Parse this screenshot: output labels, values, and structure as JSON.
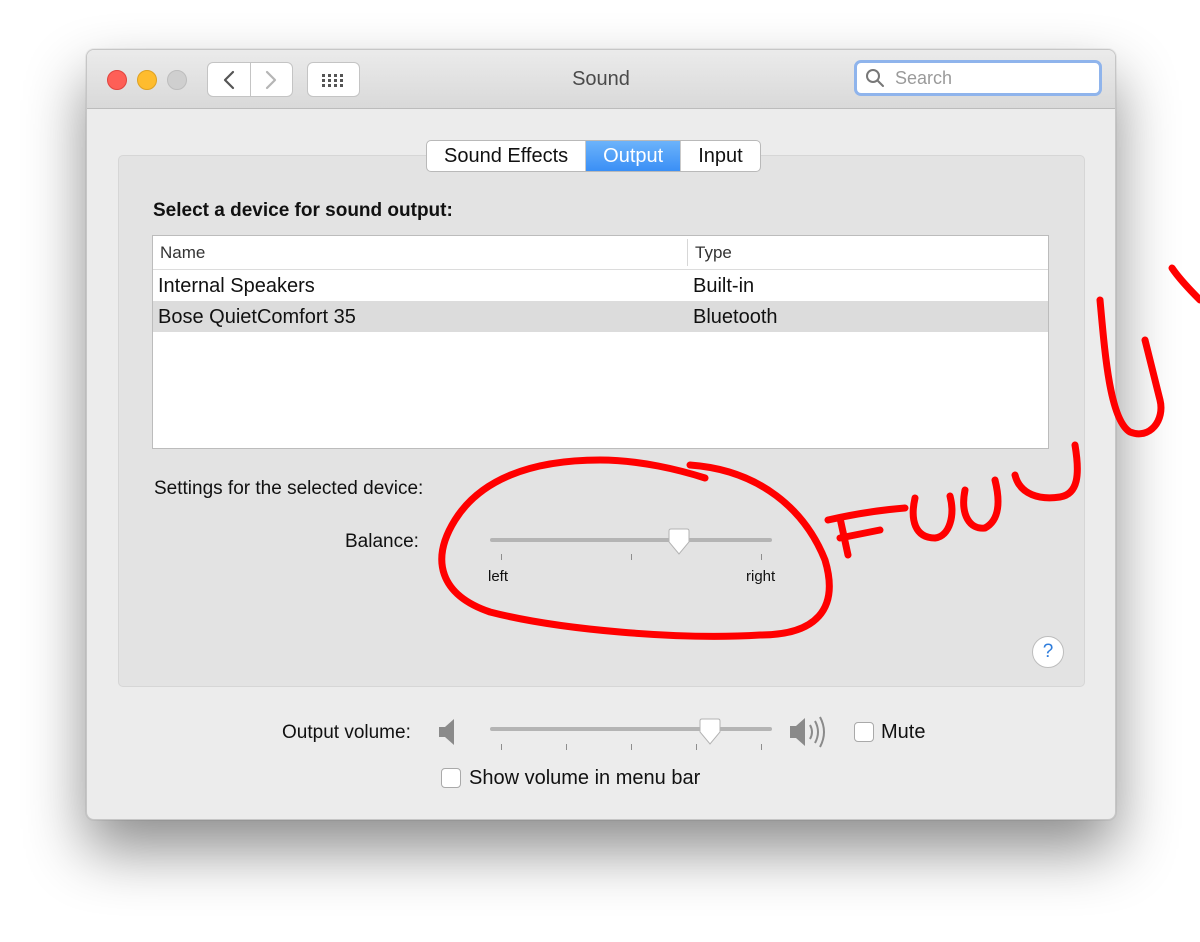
{
  "window": {
    "title": "Sound"
  },
  "search": {
    "placeholder": "Search"
  },
  "tabs": [
    {
      "label": "Sound Effects",
      "active": false
    },
    {
      "label": "Output",
      "active": true
    },
    {
      "label": "Input",
      "active": false
    }
  ],
  "output": {
    "section_title": "Select a device for sound output:",
    "columns": {
      "name": "Name",
      "type": "Type"
    },
    "devices": [
      {
        "name": "Internal Speakers",
        "type": "Built-in",
        "selected": false
      },
      {
        "name": "Bose QuietComfort 35",
        "type": "Bluetooth",
        "selected": true
      }
    ],
    "settings_title": "Settings for the selected device:",
    "balance": {
      "label": "Balance:",
      "left_label": "left",
      "right_label": "right",
      "value": 0.67
    },
    "help": "?"
  },
  "volume": {
    "label": "Output volume:",
    "value": 0.78,
    "mute_label": "Mute",
    "mute_checked": false,
    "show_in_menu_label": "Show volume in menu bar",
    "show_in_menu_checked": false
  },
  "annotation": {
    "text": "FUUU",
    "color": "#ff0000"
  }
}
